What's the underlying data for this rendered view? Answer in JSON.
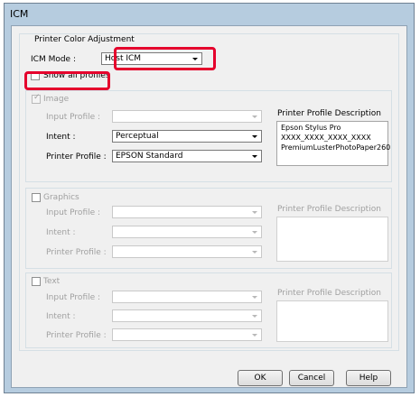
{
  "window": {
    "title": "ICM"
  },
  "group": {
    "label": "Printer Color Adjustment"
  },
  "icm_mode": {
    "label": "ICM Mode :",
    "value": "Host ICM"
  },
  "show_all_profiles": {
    "label": "Show all profiles",
    "checked": false
  },
  "image": {
    "label": "Image",
    "checked": true,
    "input_profile": {
      "label": "Input Profile :",
      "value": ""
    },
    "intent": {
      "label": "Intent :",
      "value": "Perceptual"
    },
    "printer_profile": {
      "label": "Printer Profile :",
      "value": "EPSON Standard"
    },
    "description": {
      "label": "Printer Profile Description",
      "lines": [
        "Epson Stylus Pro",
        "XXXX_XXXX_XXXX_XXXX",
        "PremiumLusterPhotoPaper260"
      ]
    }
  },
  "graphics": {
    "label": "Graphics",
    "checked": false,
    "input_profile": {
      "label": "Input Profile :",
      "value": ""
    },
    "intent": {
      "label": "Intent :",
      "value": ""
    },
    "printer_profile": {
      "label": "Printer Profile :",
      "value": ""
    },
    "description": {
      "label": "Printer Profile Description"
    }
  },
  "text": {
    "label": "Text",
    "checked": false,
    "input_profile": {
      "label": "Input Profile :",
      "value": ""
    },
    "intent": {
      "label": "Intent :",
      "value": ""
    },
    "printer_profile": {
      "label": "Printer Profile :",
      "value": ""
    },
    "description": {
      "label": "Printer Profile Description"
    }
  },
  "buttons": {
    "ok": "OK",
    "cancel": "Cancel",
    "help": "Help"
  },
  "colors": {
    "highlight": "#e5002c",
    "title_bar": "#b6ccdf",
    "client_bg": "#f0f0f0"
  }
}
